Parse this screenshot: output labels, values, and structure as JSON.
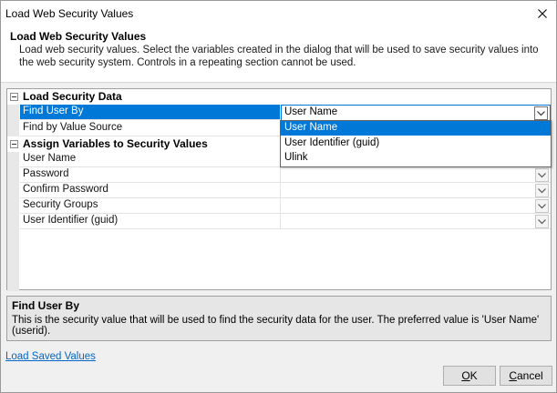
{
  "window": {
    "title": "Load Web Security Values"
  },
  "header": {
    "title": "Load Web Security Values",
    "description": "Load web security values. Select the variables created in the dialog that will be used to save security values into the web security system.  Controls in a repeating section cannot be used."
  },
  "property_grid": {
    "categories": [
      {
        "label": "Load Security Data",
        "properties": [
          {
            "name": "Find User By",
            "value": "User Name"
          },
          {
            "name": "Find by Value Source",
            "value": ""
          }
        ]
      },
      {
        "label": "Assign Variables to Security Values",
        "properties": [
          {
            "name": "User Name",
            "value": ""
          },
          {
            "name": "Password",
            "value": ""
          },
          {
            "name": "Confirm Password",
            "value": ""
          },
          {
            "name": "Security Groups",
            "value": ""
          },
          {
            "name": "User Identifier (guid)",
            "value": ""
          }
        ]
      }
    ],
    "dropdown_options": [
      "User Name",
      "User Identifier (guid)",
      "Ulink"
    ],
    "dropdown_selected": "User Name"
  },
  "help": {
    "title": "Find User By",
    "text": "This is the security value that will be used to find the security data for the user. The preferred value is 'User Name' (userid)."
  },
  "links": {
    "load_saved": "Load Saved Values"
  },
  "buttons": {
    "ok_accel": "O",
    "ok_rest": "K",
    "cancel_accel": "C",
    "cancel_rest": "ancel"
  },
  "colors": {
    "selection": "#0078d7",
    "link": "#0066cc"
  }
}
